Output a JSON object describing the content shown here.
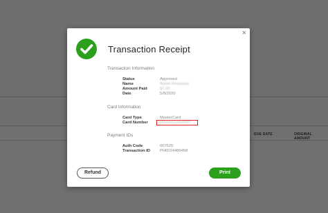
{
  "background": {
    "columns": [
      "DUE DATE",
      "ORIGINAL AMOUNT"
    ]
  },
  "dialog": {
    "title": "Transaction Receipt",
    "close_glyph": "×",
    "sections": {
      "transaction": {
        "heading": "Transaction Information",
        "rows": [
          {
            "label": "Status",
            "value": "Approved"
          },
          {
            "label": "Name",
            "value": "Name Redacted"
          },
          {
            "label": "Amount Paid",
            "value": "$7.00"
          },
          {
            "label": "Date",
            "value": "5/8/2020"
          }
        ]
      },
      "card": {
        "heading": "Card Information",
        "rows": [
          {
            "label": "Card Type",
            "value": "MasterCard"
          },
          {
            "label": "Card Number",
            "value": "xxxxxxxxxxxx3497"
          }
        ]
      },
      "payment": {
        "heading": "Payment IDs",
        "rows": [
          {
            "label": "Auth Code",
            "value": "007625"
          },
          {
            "label": "Transaction ID",
            "value": "PH0024486458"
          }
        ]
      }
    },
    "buttons": {
      "refund": "Refund",
      "print": "Print"
    },
    "colors": {
      "accent": "#2ca01c",
      "highlight": "#e02020"
    },
    "icons": {
      "status": "check-circle-icon",
      "close": "close-icon"
    }
  }
}
